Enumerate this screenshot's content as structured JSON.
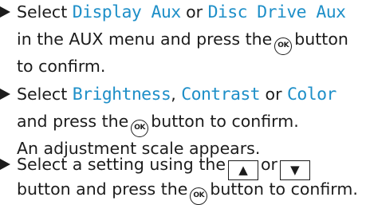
{
  "steps": [
    {
      "lines": [
        {
          "segments": [
            {
              "t": "text",
              "v": "Select "
            },
            {
              "t": "display",
              "v": "Display Aux"
            },
            {
              "t": "text",
              "v": " or "
            },
            {
              "t": "display",
              "v": "Disc Drive Aux"
            }
          ]
        },
        {
          "segments": [
            {
              "t": "text",
              "v": "in the AUX menu and press the"
            },
            {
              "t": "ok",
              "v": "OK"
            },
            {
              "t": "text",
              "v": "button"
            }
          ]
        },
        {
          "segments": [
            {
              "t": "text",
              "v": "to confirm."
            }
          ]
        }
      ]
    },
    {
      "lines": [
        {
          "segments": [
            {
              "t": "text",
              "v": "Select "
            },
            {
              "t": "display",
              "v": "Brightness"
            },
            {
              "t": "text",
              "v": ", "
            },
            {
              "t": "display",
              "v": "Contrast"
            },
            {
              "t": "text",
              "v": " or "
            },
            {
              "t": "display",
              "v": "Color"
            }
          ]
        },
        {
          "segments": [
            {
              "t": "text",
              "v": "and press the"
            },
            {
              "t": "ok",
              "v": "OK"
            },
            {
              "t": "text",
              "v": "button to confirm."
            }
          ]
        },
        {
          "segments": [
            {
              "t": "text",
              "v": "An adjustment scale appears."
            }
          ]
        }
      ]
    },
    {
      "lines": [
        {
          "segments": [
            {
              "t": "text",
              "v": "Select a setting using the"
            },
            {
              "t": "key",
              "v": "▲",
              "name": "up-arrow-key-icon"
            },
            {
              "t": "text",
              "v": "or"
            },
            {
              "t": "key",
              "v": "▼",
              "name": "down-arrow-key-icon"
            }
          ]
        },
        {
          "segments": [
            {
              "t": "text",
              "v": "button and press the"
            },
            {
              "t": "ok",
              "v": "OK"
            },
            {
              "t": "text",
              "v": "button to confirm."
            }
          ]
        }
      ]
    }
  ],
  "colors": {
    "display_text": "#1e8fc8",
    "body_text": "#1c1c1c"
  }
}
